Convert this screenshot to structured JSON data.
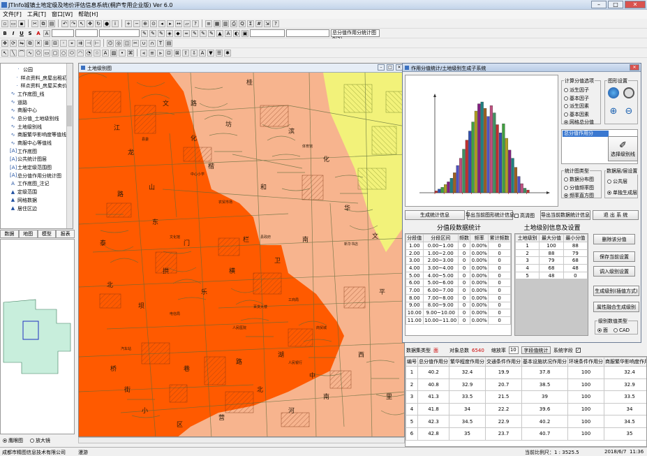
{
  "window": {
    "title": "JTInfo城镇土地定级及地价评估信息系统(桐庐专用企业版) Ver 6.0"
  },
  "menu": [
    "文件[F]",
    "工具[T]",
    "窗口[W]",
    "帮助[H]"
  ],
  "toolbar": {
    "bold_label": "B",
    "italic_label": "I",
    "underline_label": "U",
    "strike_label": "S",
    "font_label": "A",
    "layer_select": "总分值作用分统计图8(2)"
  },
  "tree_items": [
    {
      "icon": "tree-node-icon",
      "label": "公园"
    },
    {
      "icon": "tree-node-icon",
      "label": "样点资料_房屋出租初"
    },
    {
      "icon": "tree-node-icon",
      "label": "样点资料_房屋买卖价"
    },
    {
      "icon": "line-layer-icon",
      "label": "工作底图_线"
    },
    {
      "icon": "line-layer-icon",
      "label": "道路"
    },
    {
      "icon": "line-layer-icon",
      "label": "商服中心"
    },
    {
      "icon": "line-layer-icon",
      "label": "总分值_土地级别线"
    },
    {
      "icon": "line-layer-icon",
      "label": "土地级别线"
    },
    {
      "icon": "line-layer-icon",
      "label": "商服繁华影响度等值线"
    },
    {
      "icon": "line-layer-icon",
      "label": "商服中心等值线"
    },
    {
      "icon": "doc-layer-icon",
      "label": "工作底图"
    },
    {
      "icon": "doc-layer-icon",
      "label": "公共统计图层"
    },
    {
      "icon": "doc-layer-icon",
      "label": "土地定级范围图"
    },
    {
      "icon": "doc-layer-icon",
      "label": "总分值作用分统计图"
    },
    {
      "icon": "text-layer-icon",
      "label": "工作底图_注记"
    },
    {
      "icon": "polygon-layer-icon",
      "label": "定级范围"
    },
    {
      "icon": "polygon-layer-icon",
      "label": "网格数据"
    },
    {
      "icon": "polygon-layer-icon",
      "label": "居住区边"
    }
  ],
  "left_tabs": [
    "数据",
    "地图",
    "模型",
    "报表"
  ],
  "overview_radios": {
    "eagle": "鹰眼图",
    "zoom": "放大镜"
  },
  "map": {
    "title": "土地级别图",
    "labels": [
      "文",
      "化",
      "楷",
      "江",
      "龙",
      "山",
      "路",
      "东",
      "门",
      "拱",
      "北",
      "坝",
      "乐",
      "栏",
      "横",
      "卫",
      "南",
      "桥",
      "街",
      "巷",
      "路",
      "湖",
      "中",
      "营",
      "北",
      "河",
      "南",
      "西",
      "华",
      "文",
      "桂",
      "滨",
      "化",
      "路",
      "坊",
      "泰",
      "小",
      "区",
      "和",
      "平",
      "里"
    ],
    "small_labels": [
      "县政府",
      "工商局",
      "人民医院",
      "电信局",
      "商贸城",
      "中心小学",
      "县委",
      "人民银行",
      "农贸市场",
      "汽车站",
      "新华书店",
      "百货大楼",
      "体育馆",
      "文化馆"
    ]
  },
  "dialog": {
    "title": "作用分值统计/土地级别生成子系统",
    "calc_group": "计算分值选项",
    "calc_options": [
      {
        "label": "派生因子",
        "checked": false
      },
      {
        "label": "基本因子",
        "checked": false
      },
      {
        "label": "派生因素",
        "checked": false
      },
      {
        "label": "基本因素",
        "checked": false
      },
      {
        "label": "网格总分值",
        "checked": true
      }
    ],
    "graph_settings": "图形设置",
    "total_score_label": "总分值作用分",
    "select_level_btn": "选择级别线",
    "chart_type_group": "统计图类型",
    "chart_types": [
      {
        "label": "数据分布图",
        "checked": false
      },
      {
        "label": "分值频率图",
        "checked": false
      },
      {
        "label": "频率直方图",
        "checked": true
      }
    ],
    "data_layer_group": "数据层/层设置",
    "data_layers": [
      {
        "label": "公共层",
        "checked": false
      },
      {
        "label": "单独生成层",
        "checked": true
      }
    ],
    "buttons": {
      "gen_stats": "生成统计信息",
      "export_chart": "导出当前图形统计信息",
      "hd_label": "高清图",
      "export_stats": "导出当前数据统计信息",
      "exit": "退 出 系 统",
      "delete_class": "删除该分值",
      "save_settings": "保存当前设置",
      "load_settings": "调入级别设置",
      "gen_level_interp": "生成级别(插值方式)",
      "gen_level_merge": "属性融合生成级别"
    },
    "seg_title": "分值段数据统计",
    "seg_headers": [
      "分段值",
      "分段区间",
      "频数",
      "频率",
      "累计频数"
    ],
    "seg_rows": [
      [
        "1.00",
        "0.00~1.00",
        "0",
        "0.00%",
        "0"
      ],
      [
        "2.00",
        "1.00~2.00",
        "0",
        "0.00%",
        "0"
      ],
      [
        "3.00",
        "2.00~3.00",
        "0",
        "0.00%",
        "0"
      ],
      [
        "4.00",
        "3.00~4.00",
        "0",
        "0.00%",
        "0"
      ],
      [
        "5.00",
        "4.00~5.00",
        "0",
        "0.00%",
        "0"
      ],
      [
        "6.00",
        "5.00~6.00",
        "0",
        "0.00%",
        "0"
      ],
      [
        "7.00",
        "6.00~7.00",
        "0",
        "0.00%",
        "0"
      ],
      [
        "8.00",
        "7.00~8.00",
        "0",
        "0.00%",
        "0"
      ],
      [
        "9.00",
        "8.00~9.00",
        "0",
        "0.00%",
        "0"
      ],
      [
        "10.00",
        "9.00~10.00",
        "0",
        "0.00%",
        "0"
      ],
      [
        "11.00",
        "10.00~11.00",
        "0",
        "0.00%",
        "0"
      ]
    ],
    "level_title": "土地级别信息及设置",
    "level_headers": [
      "土地级别",
      "最大分值",
      "最小分值"
    ],
    "level_rows": [
      [
        "1",
        "100",
        "88"
      ],
      [
        "2",
        "88",
        "79"
      ],
      [
        "3",
        "79",
        "68"
      ],
      [
        "4",
        "68",
        "48"
      ],
      [
        "5",
        "48",
        "0"
      ]
    ],
    "level_type_group": "级别数值类型",
    "level_type_options": [
      {
        "label": "面",
        "checked": true
      },
      {
        "label": "CAD",
        "checked": false
      }
    ]
  },
  "chart_data": {
    "type": "bar",
    "title": "",
    "xlabel": "",
    "ylabel": "",
    "values": [
      2,
      4,
      6,
      9,
      12,
      16,
      22,
      30,
      38,
      48,
      58,
      68,
      78,
      90,
      98,
      100,
      93,
      84,
      96,
      88,
      75,
      66,
      76,
      60,
      47,
      38,
      28,
      18,
      10,
      5,
      3
    ],
    "colors": [
      "#c03030",
      "#3050b0",
      "#40a040",
      "#b0a020",
      "#802080",
      "#208080",
      "#a06020",
      "#5050c0",
      "#c05080",
      "#409060"
    ]
  },
  "bottom": {
    "data_type_label": "数据集类型",
    "data_type_value": "面",
    "object_count_label": "对象总数",
    "object_count_value": "6540",
    "scale_label": "缩放率",
    "scale_value": "10",
    "seg_stats_btn": "字段值统计",
    "system_field_label": "系统字段",
    "headers": [
      "编号",
      "总分值作用分",
      "繁华程度作用分",
      "交通条件作用分",
      "基本设施状况作用分",
      "环境条件作用分",
      "商服繁华影响度作用分"
    ],
    "rows": [
      [
        "1",
        "40.2",
        "32.4",
        "19.9",
        "37.8",
        "100",
        "32.4"
      ],
      [
        "2",
        "40.8",
        "32.9",
        "20.7",
        "38.5",
        "100",
        "32.9"
      ],
      [
        "3",
        "41.3",
        "33.5",
        "21.5",
        "39",
        "100",
        "33.5"
      ],
      [
        "4",
        "41.8",
        "34",
        "22.2",
        "39.6",
        "100",
        "34"
      ],
      [
        "5",
        "42.3",
        "34.5",
        "22.9",
        "40.2",
        "100",
        "34.5"
      ],
      [
        "6",
        "42.8",
        "35",
        "23.7",
        "40.7",
        "100",
        "35"
      ]
    ]
  },
  "status": {
    "company": "成都市精图信息技术有限公司",
    "mode": "漫游",
    "scale": "当前比例尺：1 : 3525.5",
    "date": "2018/6/7",
    "time": "11:36"
  },
  "colors": {
    "level1": "#ff5a00",
    "level2": "#f7b48e",
    "level3": "#f2f27a",
    "title_bg": "#c4d5ea"
  }
}
